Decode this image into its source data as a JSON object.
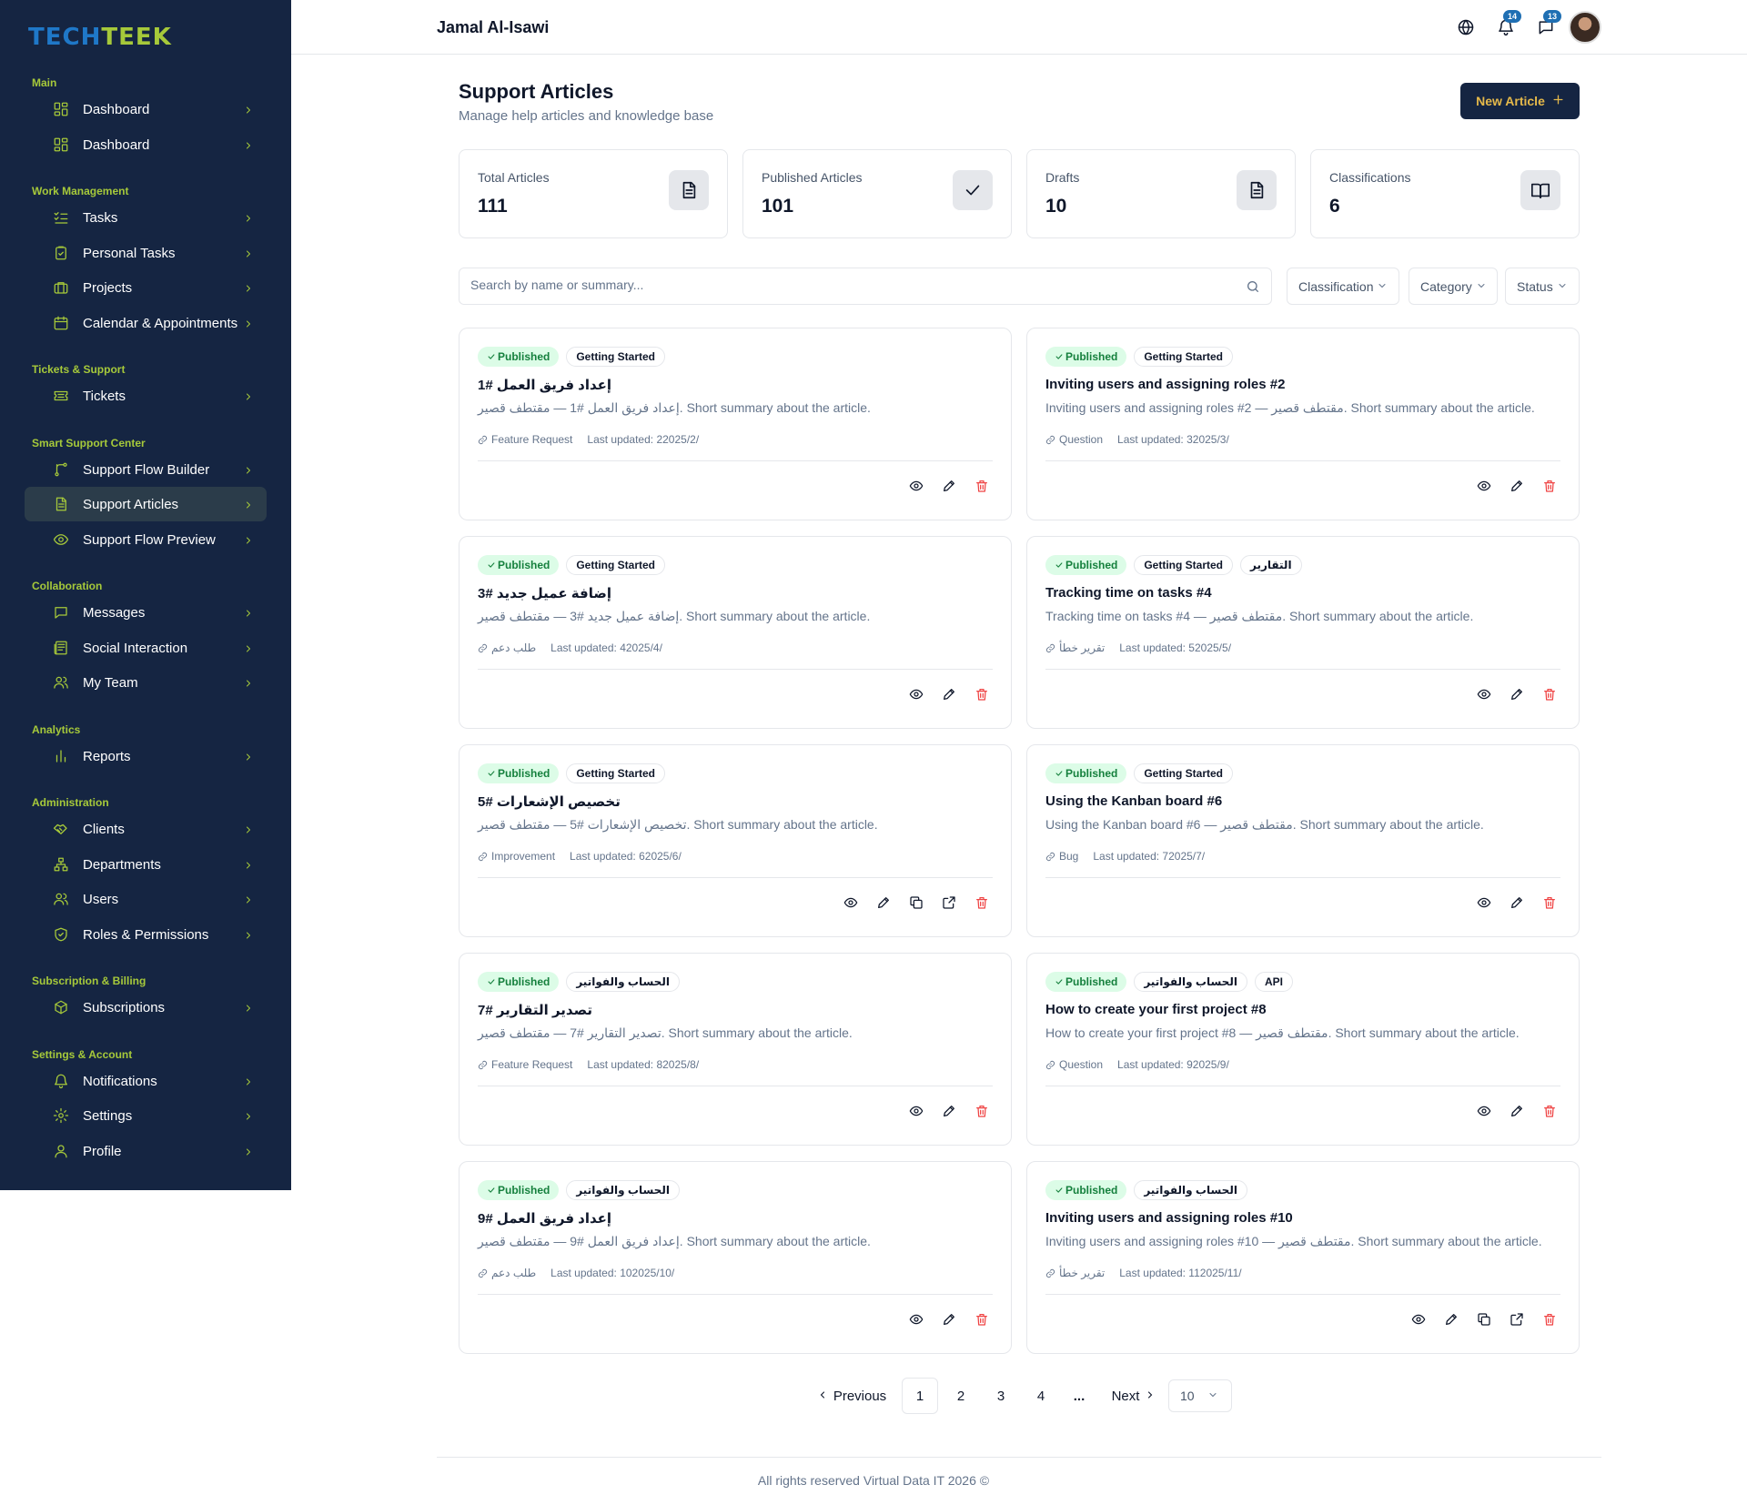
{
  "brand": {
    "part1": "TECH",
    "part2": "TEEK"
  },
  "sidebar": {
    "sections": [
      {
        "title": "Main",
        "items": [
          {
            "label": "Dashboard",
            "icon": "grid-icon"
          },
          {
            "label": "Dashboard",
            "icon": "grid-icon"
          }
        ]
      },
      {
        "title": "Work Management",
        "items": [
          {
            "label": "Tasks",
            "icon": "checklist-icon"
          },
          {
            "label": "Personal Tasks",
            "icon": "clipboard-check-icon"
          },
          {
            "label": "Projects",
            "icon": "briefcase-icon"
          },
          {
            "label": "Calendar & Appointments",
            "icon": "calendar-icon"
          }
        ]
      },
      {
        "title": "Tickets & Support",
        "items": [
          {
            "label": "Tickets",
            "icon": "ticket-icon"
          }
        ]
      },
      {
        "title": "Smart Support Center",
        "items": [
          {
            "label": "Support Flow Builder",
            "icon": "flow-icon"
          },
          {
            "label": "Support Articles",
            "icon": "document-icon",
            "active": true
          },
          {
            "label": "Support Flow Preview",
            "icon": "eye-icon"
          }
        ]
      },
      {
        "title": "Collaboration",
        "items": [
          {
            "label": "Messages",
            "icon": "message-icon"
          },
          {
            "label": "Social Interaction",
            "icon": "newspaper-icon"
          },
          {
            "label": "My Team",
            "icon": "users-icon"
          }
        ]
      },
      {
        "title": "Analytics",
        "items": [
          {
            "label": "Reports",
            "icon": "bar-chart-icon"
          }
        ]
      },
      {
        "title": "Administration",
        "items": [
          {
            "label": "Clients",
            "icon": "handshake-icon"
          },
          {
            "label": "Departments",
            "icon": "org-chart-icon"
          },
          {
            "label": "Users",
            "icon": "users-icon"
          },
          {
            "label": "Roles & Permissions",
            "icon": "shield-icon"
          }
        ]
      },
      {
        "title": "Subscription & Billing",
        "items": [
          {
            "label": "Subscriptions",
            "icon": "package-icon"
          }
        ]
      },
      {
        "title": "Settings & Account",
        "items": [
          {
            "label": "Notifications",
            "icon": "bell-icon"
          },
          {
            "label": "Settings",
            "icon": "gear-icon"
          },
          {
            "label": "Profile",
            "icon": "user-icon"
          }
        ]
      }
    ]
  },
  "topbar": {
    "user_name": "Jamal Al-Isawi",
    "notifications_count": "14",
    "messages_count": "13"
  },
  "header": {
    "title": "Support Articles",
    "subtitle": "Manage help articles and knowledge base",
    "new_button": "New Article"
  },
  "stats": [
    {
      "label": "Total Articles",
      "value": "111",
      "icon": "document-icon"
    },
    {
      "label": "Published Articles",
      "value": "101",
      "icon": "check-icon"
    },
    {
      "label": "Drafts",
      "value": "10",
      "icon": "document-icon"
    },
    {
      "label": "Classifications",
      "value": "6",
      "icon": "book-open-icon"
    }
  ],
  "search": {
    "placeholder": "Search by name or summary..."
  },
  "filters": {
    "classification": "Classification",
    "category": "Category",
    "status": "Status"
  },
  "cards": [
    {
      "status": "Published",
      "tags": [
        "Getting Started"
      ],
      "title": "إعداد فريق العمل #1",
      "summary": "إعداد فريق العمل #1 — مقتطف قصير. Short summary about the article.",
      "type": "Feature Request",
      "updated": "Last updated: 22025/2/",
      "actions": [
        "view",
        "edit",
        "delete"
      ]
    },
    {
      "status": "Published",
      "tags": [
        "Getting Started"
      ],
      "title": "Inviting users and assigning roles #2",
      "summary": "Inviting users and assigning roles #2 — مقتطف قصير. Short summary about the article.",
      "type": "Question",
      "updated": "Last updated: 32025/3/",
      "actions": [
        "view",
        "edit",
        "delete"
      ]
    },
    {
      "status": "Published",
      "tags": [
        "Getting Started"
      ],
      "title": "إضافة عميل جديد #3",
      "summary": "إضافة عميل جديد #3 — مقتطف قصير. Short summary about the article.",
      "type": "طلب دعم",
      "updated": "Last updated: 42025/4/",
      "actions": [
        "view",
        "edit",
        "delete"
      ]
    },
    {
      "status": "Published",
      "tags": [
        "Getting Started",
        "التقارير"
      ],
      "title": "Tracking time on tasks #4",
      "summary": "Tracking time on tasks #4 — مقتطف قصير. Short summary about the article.",
      "type": "تقرير خطأ",
      "updated": "Last updated: 52025/5/",
      "actions": [
        "view",
        "edit",
        "delete"
      ]
    },
    {
      "status": "Published",
      "tags": [
        "Getting Started"
      ],
      "title": "تخصيص الإشعارات #5",
      "summary": "تخصيص الإشعارات #5 — مقتطف قصير. Short summary about the article.",
      "type": "Improvement",
      "updated": "Last updated: 62025/6/",
      "actions": [
        "view",
        "edit",
        "duplicate",
        "external",
        "delete"
      ]
    },
    {
      "status": "Published",
      "tags": [
        "Getting Started"
      ],
      "title": "Using the Kanban board #6",
      "summary": "Using the Kanban board #6 — مقتطف قصير. Short summary about the article.",
      "type": "Bug",
      "updated": "Last updated: 72025/7/",
      "actions": [
        "view",
        "edit",
        "delete"
      ]
    },
    {
      "status": "Published",
      "tags": [
        "الحساب والفواتير"
      ],
      "title": "تصدير التقارير #7",
      "summary": "تصدير التقارير #7 — مقتطف قصير. Short summary about the article.",
      "type": "Feature Request",
      "updated": "Last updated: 82025/8/",
      "actions": [
        "view",
        "edit",
        "delete"
      ]
    },
    {
      "status": "Published",
      "tags": [
        "الحساب والفواتير",
        "API"
      ],
      "title": "How to create your first project #8",
      "summary": "How to create your first project #8 — مقتطف قصير. Short summary about the article.",
      "type": "Question",
      "updated": "Last updated: 92025/9/",
      "actions": [
        "view",
        "edit",
        "delete"
      ]
    },
    {
      "status": "Published",
      "tags": [
        "الحساب والفواتير"
      ],
      "title": "إعداد فريق العمل #9",
      "summary": "إعداد فريق العمل #9 — مقتطف قصير. Short summary about the article.",
      "type": "طلب دعم",
      "updated": "Last updated: 102025/10/",
      "actions": [
        "view",
        "edit",
        "delete"
      ]
    },
    {
      "status": "Published",
      "tags": [
        "الحساب والفواتير"
      ],
      "title": "Inviting users and assigning roles #10",
      "summary": "Inviting users and assigning roles #10 — مقتطف قصير. Short summary about the article.",
      "type": "تقرير خطأ",
      "updated": "Last updated: 112025/11/",
      "actions": [
        "view",
        "edit",
        "duplicate",
        "external",
        "delete"
      ]
    }
  ],
  "pagination": {
    "previous": "Previous",
    "pages": [
      "1",
      "2",
      "3",
      "4"
    ],
    "ellipsis": "...",
    "next": "Next",
    "current": "1",
    "per_page": "10"
  },
  "footer": {
    "text": "All rights reserved Virtual Data IT 2026 ©"
  },
  "colors": {
    "sidebar_bg": "#152542",
    "accent_green": "#a6c93a",
    "brand_blue": "#1f78c8",
    "button_text": "#e5b94a",
    "delete_red": "#ef4444",
    "published_bg": "#dcfce7",
    "published_text": "#15803d"
  }
}
